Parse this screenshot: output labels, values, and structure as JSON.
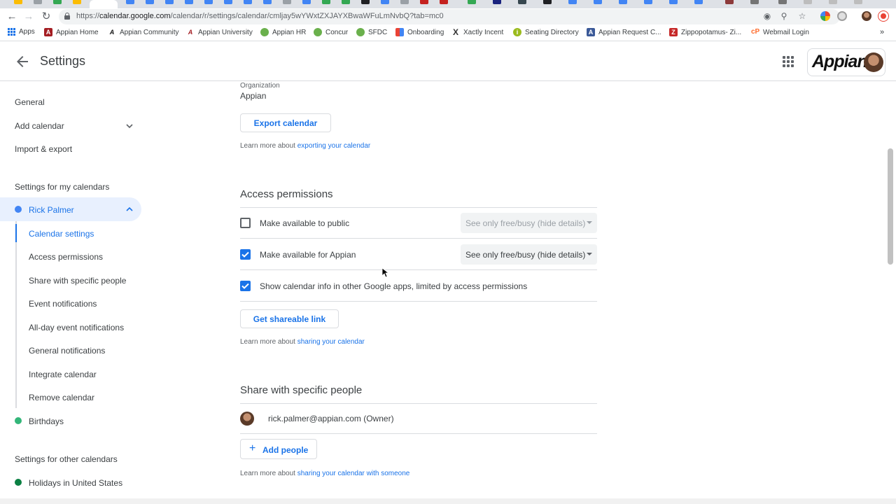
{
  "browser": {
    "url_prefix": "https://",
    "url_host": "calendar.google.com",
    "url_path": "/calendar/r/settings/calendar/cmljay5wYWxtZXJAYXBwaWFuLmNvbQ?tab=mc0",
    "bookmarks": [
      {
        "label": "Apps",
        "icon": "apps-grid-icon"
      },
      {
        "label": "Appian Home",
        "icon": "appian-icon",
        "color": "#a41e23"
      },
      {
        "label": "Appian Community",
        "icon": "appian-a-icon",
        "color": "#111111"
      },
      {
        "label": "Appian University",
        "icon": "appian-a-icon",
        "color": "#a41e23"
      },
      {
        "label": "Appian HR",
        "icon": "circle-icon",
        "color": "#6ab04c"
      },
      {
        "label": "Concur",
        "icon": "circle-icon",
        "color": "#6ab04c"
      },
      {
        "label": "SFDC",
        "icon": "circle-icon",
        "color": "#6ab04c"
      },
      {
        "label": "Onboarding",
        "icon": "flag-icon",
        "color": "#4285f4"
      },
      {
        "label": "Xactly Incent",
        "icon": "x-icon",
        "color": "#333333"
      },
      {
        "label": "Seating Directory",
        "icon": "info-icon",
        "color": "#9bbb1e"
      },
      {
        "label": "Appian Request C...",
        "icon": "a-box-icon",
        "color": "#3b5998"
      },
      {
        "label": "Zippopotamus- Zi...",
        "icon": "z-icon",
        "color": "#c62828"
      },
      {
        "label": "Webmail Login",
        "icon": "cpanel-icon",
        "color": "#ff6c2c"
      }
    ]
  },
  "header": {
    "title": "Settings",
    "brand": "Appian"
  },
  "sidebar": {
    "general": "General",
    "add_calendar": "Add calendar",
    "import_export": "Import & export",
    "my_calendars_heading": "Settings for my calendars",
    "my_calendar_name": "Rick Palmer",
    "my_calendar_color": "#4285f4",
    "sub_items": [
      "Calendar settings",
      "Access permissions",
      "Share with specific people",
      "Event notifications",
      "All-day event notifications",
      "General notifications",
      "Integrate calendar",
      "Remove calendar"
    ],
    "birthdays": "Birthdays",
    "birthdays_color": "#33b679",
    "other_calendars_heading": "Settings for other calendars",
    "holidays": "Holidays in United States",
    "holidays_color": "#0b8043"
  },
  "main": {
    "organization_label": "Organization",
    "organization_value": "Appian",
    "export_button": "Export calendar",
    "export_learn_prefix": "Learn more about ",
    "export_learn_link": "exporting your calendar",
    "access_title": "Access permissions",
    "permissions": [
      {
        "label": "Make available to public",
        "checked": false,
        "dropdown": "See only free/busy (hide details)",
        "dropdown_enabled": false
      },
      {
        "label": "Make available for Appian",
        "checked": true,
        "dropdown": "See only free/busy (hide details)",
        "dropdown_enabled": true
      },
      {
        "label": "Show calendar info in other Google apps, limited by access permissions",
        "checked": true
      }
    ],
    "shareable_button": "Get shareable link",
    "sharing_learn_prefix": "Learn more about ",
    "sharing_learn_link": "sharing your calendar",
    "share_title": "Share with specific people",
    "person": "rick.palmer@appian.com (Owner)",
    "add_people_button": "Add people",
    "share_learn_prefix": "Learn more about ",
    "share_learn_link": "sharing your calendar with someone"
  },
  "accent_color": "#1a73e8"
}
